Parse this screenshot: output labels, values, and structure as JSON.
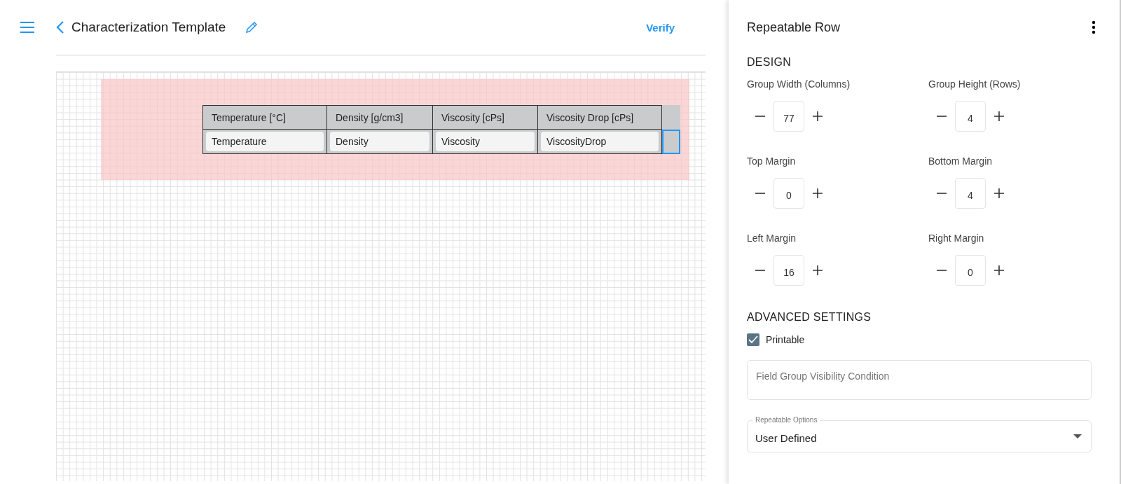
{
  "header": {
    "title": "Characterization Template",
    "action": "Verify"
  },
  "table": {
    "columns": [
      "Temperature [°C]",
      "Density [g/cm3]",
      "Viscosity [cPs]",
      "Viscosity Drop [cPs]"
    ],
    "row": [
      "Temperature",
      "Density",
      "Viscosity",
      "ViscosityDrop"
    ]
  },
  "panel": {
    "title": "Repeatable Row",
    "design": {
      "heading": "DESIGN",
      "steppers": [
        {
          "label": "Group Width (Columns)",
          "value": "77"
        },
        {
          "label": "Group Height (Rows)",
          "value": "4"
        },
        {
          "label": "Top Margin",
          "value": "0"
        },
        {
          "label": "Bottom Margin",
          "value": "4"
        },
        {
          "label": "Left Margin",
          "value": "16"
        },
        {
          "label": "Right Margin",
          "value": "0"
        }
      ]
    },
    "advanced": {
      "heading": "ADVANCED SETTINGS",
      "checkbox": {
        "label": "Printable",
        "checked": true
      },
      "condition": {
        "placeholder": "Field Group Visibility Condition"
      },
      "select": {
        "label": "Repeatable Options",
        "value": "User Defined"
      }
    }
  }
}
